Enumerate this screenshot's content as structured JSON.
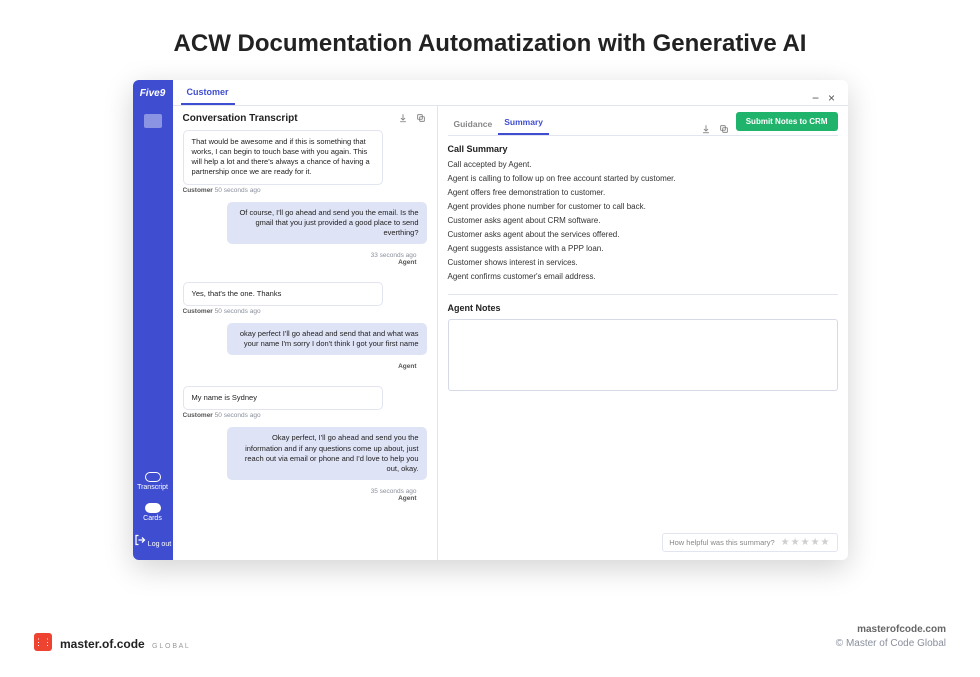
{
  "page": {
    "title": "ACW Documentation Automatization with Generative AI"
  },
  "sidebar": {
    "logo": "Five9",
    "items": [
      {
        "label": "Transcript"
      },
      {
        "label": "Cards"
      },
      {
        "label": "Log out"
      }
    ]
  },
  "topbar": {
    "tab": "Customer"
  },
  "transcript": {
    "title": "Conversation Transcript",
    "messages": [
      {
        "side": "cust",
        "text": "That would be awesome and if this is something that works, I can begin to touch base with you again. This will help a lot and there's always a chance of having a partnership once we are ready for it.",
        "who": "Customer",
        "time": "50 seconds ago"
      },
      {
        "side": "agent",
        "text": "Of course, I'll go ahead and send you the email. Is the gmail that you just provided a good place to send everthing?",
        "who": "Agent",
        "time": "33 seconds ago"
      },
      {
        "side": "cust",
        "text": "Yes, that's the one. Thanks",
        "who": "Customer",
        "time": "50 seconds ago"
      },
      {
        "side": "agent",
        "text": "okay perfect I'll go ahead and send that and what was your name I'm sorry I don't think I got your first name",
        "who": "Agent",
        "time": ""
      },
      {
        "side": "cust",
        "text": "My name is Sydney",
        "who": "Customer",
        "time": "50 seconds ago"
      },
      {
        "side": "agent",
        "text": "Okay perfect, I'll go ahead and send you the information and if any questions come up about, just reach out via email or phone and I'd love to help you out, okay.",
        "who": "Agent",
        "time": "35 seconds ago"
      }
    ]
  },
  "right": {
    "tabs": {
      "guidance": "Guidance",
      "summary": "Summary"
    },
    "submit": "Submit Notes to CRM",
    "summary_title": "Call Summary",
    "summary_lines": [
      "Call accepted by Agent.",
      "Agent is calling to follow up on free account started by customer.",
      "Agent offers free demonstration to customer.",
      "Agent provides phone number for customer to call back.",
      "Customer asks agent about CRM software.",
      "Customer asks agent about the services offered.",
      "Agent suggests assistance with a PPP loan.",
      "Customer shows interest in services.",
      "Agent confirms customer's email address."
    ],
    "notes_title": "Agent Notes",
    "rating_prompt": "How helpful was this summary?"
  },
  "footer": {
    "brand": "master.of.code",
    "brand_sub": "G L O B A L",
    "site": "masterofcode.com",
    "copyright": "© Master of Code Global"
  }
}
